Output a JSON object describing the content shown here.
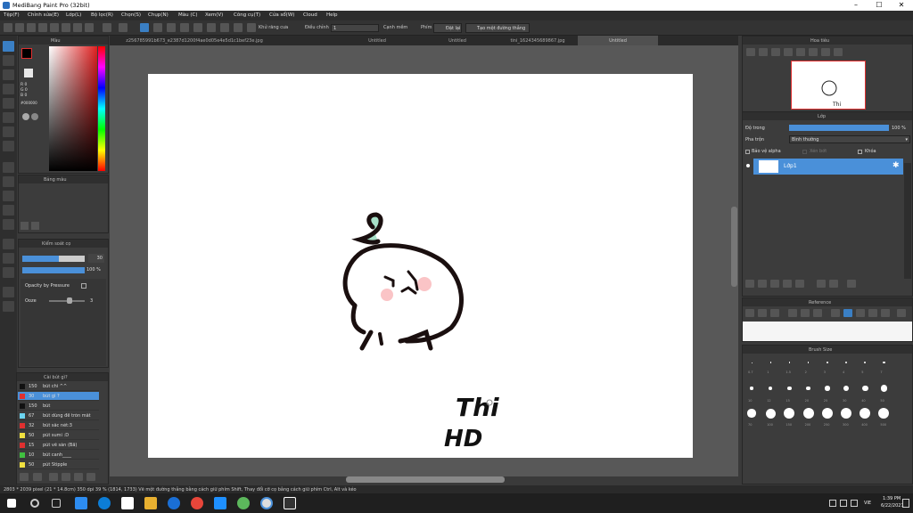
{
  "app": {
    "title": "MediBang Paint Pro (32bit)"
  },
  "window": {
    "minimize": "–",
    "maximize": "☐",
    "close": "✕"
  },
  "menu": [
    "Tệp(F)",
    "Chỉnh sửa(E)",
    "Lớp(L)",
    "Bộ lọc(R)",
    "Chọn(S)",
    "Chụp(N)",
    "Màu (C)",
    "Xem(V)",
    "Công cụ(T)",
    "Cửa sổ(W)",
    "Cloud",
    "Help"
  ],
  "toolbar": {
    "smooth_label": "Khử răng cưa",
    "adjust_label": "Điều chỉnh",
    "adjust_value": "1",
    "corner_label": "Cạnh mềm",
    "key_label": "Phím",
    "key_value": "Đặt lại",
    "straight_label": "Tạo một đường thẳng"
  },
  "tabs": [
    "z256785991b673_e2387d1200f4ae0d05e4e5d1c1bef23e.jpg",
    "Untitled",
    "Untitled",
    "tini_1624345689867.jpg",
    "Untitled"
  ],
  "color_panel": {
    "title": "Màu",
    "r": "R 0",
    "g": "G 0",
    "b": "B 0",
    "hex": "#000000"
  },
  "palette_panel": {
    "title": "Bảng màu"
  },
  "brush_control": {
    "title": "Kiểm soát cọ",
    "size_value": "30",
    "opacity_value": "100 %",
    "opacity_pressure": "Opacity by Pressure",
    "ooze_label": "Ooze",
    "ooze_value": "3"
  },
  "brush_list": {
    "title": "Cài bút gì?",
    "items": [
      {
        "num": "150",
        "name": "bút chì ^^",
        "color": "#111111"
      },
      {
        "num": "30",
        "name": "bút gì ?",
        "color": "#e03030"
      },
      {
        "num": "150",
        "name": "bút",
        "color": "#111111"
      },
      {
        "num": "67",
        "name": "bút dùng để tròn mắt",
        "color": "#6cd4f0"
      },
      {
        "num": "32",
        "name": "bút sắc nét:3",
        "color": "#e03030"
      },
      {
        "num": "50",
        "name": "pút sumi :D",
        "color": "#f0e040"
      },
      {
        "num": "15",
        "name": "pút vẽ sàn (Bẩ)",
        "color": "#e03030"
      },
      {
        "num": "10",
        "name": "bút canh____",
        "color": "#40c040"
      },
      {
        "num": "50",
        "name": "pút Stipple",
        "color": "#f0e040"
      }
    ]
  },
  "navigator": {
    "title": "Hoa tiêu"
  },
  "layer_panel": {
    "title": "Lớp",
    "opacity_label": "Độ trong",
    "opacity_value": "100 %",
    "blend_label": "Pha trộn",
    "blend_value": "Bình thường",
    "protect_alpha": "Bảo vệ alpha",
    "clip": "Xén bớt",
    "lock": "Khóa",
    "layer_name": "Lớp1"
  },
  "reference": {
    "title": "Reference"
  },
  "brush_size": {
    "title": "Brush Size",
    "sizes": [
      "0.7",
      "1",
      "1.5",
      "2",
      "3",
      "4",
      "5",
      "7",
      "10",
      "12",
      "15",
      "20",
      "25",
      "30",
      "40",
      "50",
      "70",
      "100",
      "150",
      "200",
      "250",
      "300",
      "400",
      "500",
      "700",
      "1000"
    ]
  },
  "canvas_text": {
    "word1": "Thi",
    "word2": "HD"
  },
  "status": {
    "text": "2803 * 2039 pixel (21 * 14.8cm) 350 dpi 39 % (1814, 1733) Vẽ một đường thẳng bằng cách giữ phím Shift, Thay đổi cỡ cọ bằng cách giữ phím Ctrl, Alt và kéo"
  },
  "taskbar": {
    "time": "1:39 PM",
    "date": "6/22/2021",
    "lang": "VIE"
  },
  "colors": {
    "accent": "#4a90d9",
    "panel": "#3c3c3c",
    "canvas_bg": "#585858"
  }
}
